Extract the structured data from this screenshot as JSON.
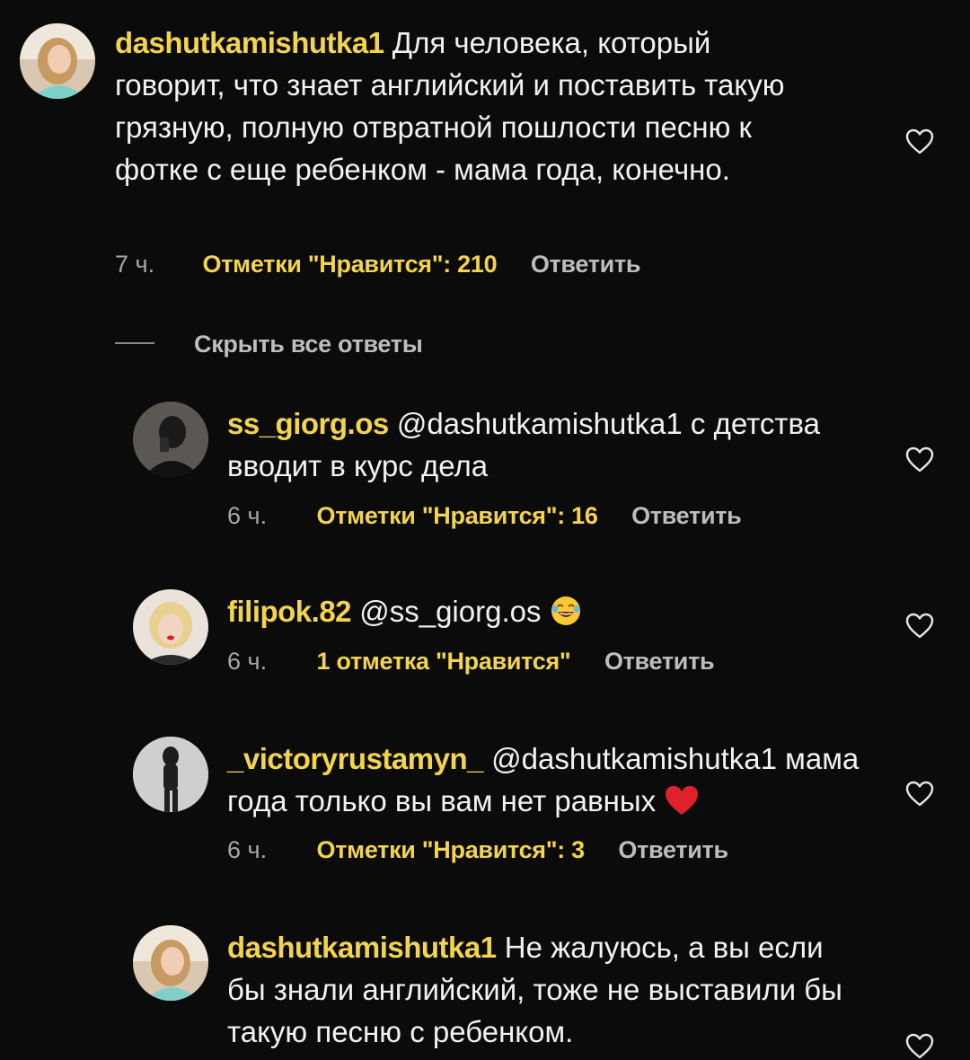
{
  "comments": [
    {
      "username": "dashutkamishutka1",
      "mention": "",
      "text": "Для человека, который говорит, что знает английский и поставить такую грязную, полную отвратной пошлости песню к фотке с еще ребенком - мама года, конечно.",
      "time": "7 ч.",
      "likes": "Отметки \"Нравится\": 210",
      "reply": "Ответить"
    },
    {
      "username": "ss_giorg.os",
      "mention": "@dashutkamishutka1",
      "text": "с детства вводит в курс дела",
      "time": "6 ч.",
      "likes": "Отметки \"Нравится\": 16",
      "reply": "Ответить"
    },
    {
      "username": "filipok.82",
      "mention": "@ss_giorg.os",
      "text": "",
      "time": "6 ч.",
      "likes": "1 отметка \"Нравится\"",
      "reply": "Ответить"
    },
    {
      "username": "_victoryrustamyn_",
      "mention": "@dashutkamishutka1",
      "text": "мама года только вы вам нет равных",
      "time": "6 ч.",
      "likes": "Отметки \"Нравится\": 3",
      "reply": "Ответить"
    },
    {
      "username": "dashutkamishutka1",
      "mention": "",
      "text": "Не жалуюсь, а вы если бы знали английский, тоже не выставили бы такую песню с ребенком.",
      "time": "",
      "likes": "",
      "reply": ""
    }
  ],
  "hide_replies": "Скрыть все ответы",
  "icons": {
    "heart": "heart-outline-icon",
    "laugh_emoji": "tears-of-joy-emoji",
    "red_heart_emoji": "red-heart-emoji"
  },
  "colors": {
    "background": "#0b0b0b",
    "username": "#f3d44e",
    "text": "#f2f2f2",
    "meta": "#a8a8a8"
  }
}
